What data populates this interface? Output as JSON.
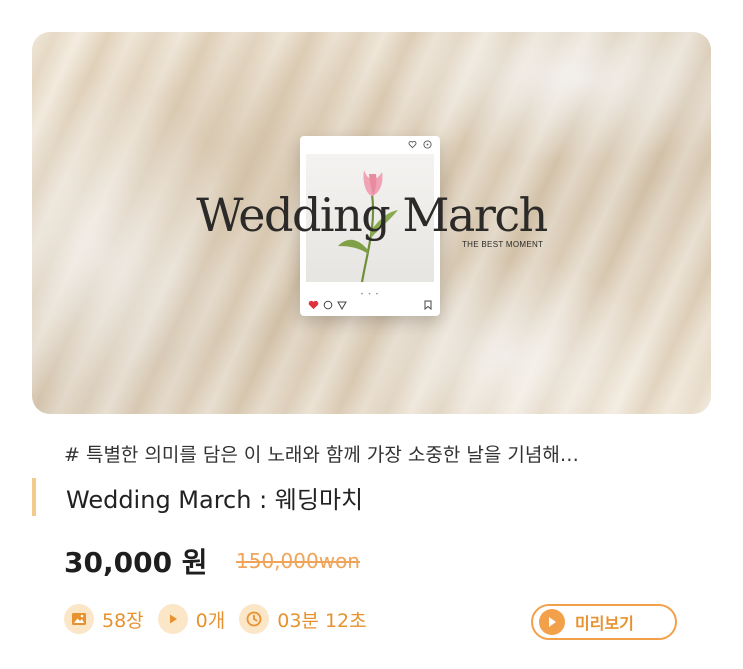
{
  "hero": {
    "title": "Wedding March",
    "subtitle": "THE BEST MOMENT",
    "icons": [
      "heart-icon",
      "comment-icon",
      "send-icon",
      "bookmark-icon",
      "like-outline-icon",
      "more-icon"
    ]
  },
  "product": {
    "tags": "# 특별한 의미를 담은 이 노래와 함께 가장 소중한 날을 기념해…",
    "title": "Wedding March : 웨딩마치",
    "price": "30,000 원",
    "original_price": "150,000won"
  },
  "stats": {
    "photos": "58장",
    "videos": "0개",
    "duration": "03분 12초"
  },
  "preview_button": {
    "label": "미리보기"
  },
  "colors": {
    "accent": "#f3a04a",
    "accent_text": "#e7922f",
    "icon_bg": "#fbe6c8",
    "title_bar": "#f4c98e"
  }
}
